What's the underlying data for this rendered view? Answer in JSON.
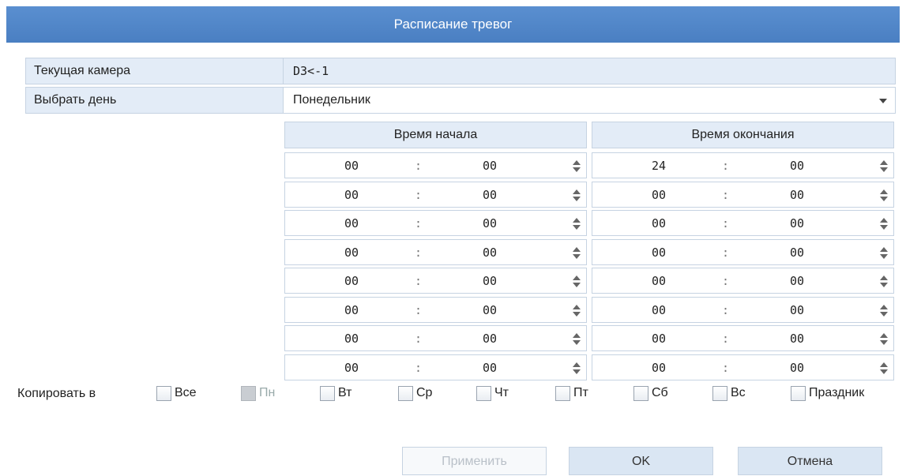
{
  "dialog": {
    "title": "Расписание тревог"
  },
  "camera": {
    "label": "Текущая камера",
    "value": "D3<-1"
  },
  "day": {
    "label": "Выбрать день",
    "value": "Понедельник"
  },
  "columns": {
    "start": "Время начала",
    "end": "Время окончания"
  },
  "separator": ":",
  "schedule": [
    {
      "start_h": "00",
      "start_m": "00",
      "end_h": "24",
      "end_m": "00"
    },
    {
      "start_h": "00",
      "start_m": "00",
      "end_h": "00",
      "end_m": "00"
    },
    {
      "start_h": "00",
      "start_m": "00",
      "end_h": "00",
      "end_m": "00"
    },
    {
      "start_h": "00",
      "start_m": "00",
      "end_h": "00",
      "end_m": "00"
    },
    {
      "start_h": "00",
      "start_m": "00",
      "end_h": "00",
      "end_m": "00"
    },
    {
      "start_h": "00",
      "start_m": "00",
      "end_h": "00",
      "end_m": "00"
    },
    {
      "start_h": "00",
      "start_m": "00",
      "end_h": "00",
      "end_m": "00"
    },
    {
      "start_h": "00",
      "start_m": "00",
      "end_h": "00",
      "end_m": "00"
    }
  ],
  "copy": {
    "label": "Копировать в",
    "options": [
      {
        "label": "Все",
        "checked": false,
        "disabled": false
      },
      {
        "label": "Пн",
        "checked": false,
        "disabled": true
      },
      {
        "label": "Вт",
        "checked": false,
        "disabled": false
      },
      {
        "label": "Ср",
        "checked": false,
        "disabled": false
      },
      {
        "label": "Чт",
        "checked": false,
        "disabled": false
      },
      {
        "label": "Пт",
        "checked": false,
        "disabled": false
      },
      {
        "label": "Сб",
        "checked": false,
        "disabled": false
      },
      {
        "label": "Вс",
        "checked": false,
        "disabled": false
      },
      {
        "label": "Праздник",
        "checked": false,
        "disabled": false
      }
    ]
  },
  "buttons": {
    "apply": "Применить",
    "ok": "OK",
    "cancel": "Отмена"
  },
  "colors": {
    "titlebar": "#4a7fc2",
    "label_bg": "#e3ecf7",
    "border": "#c6d3e2"
  }
}
